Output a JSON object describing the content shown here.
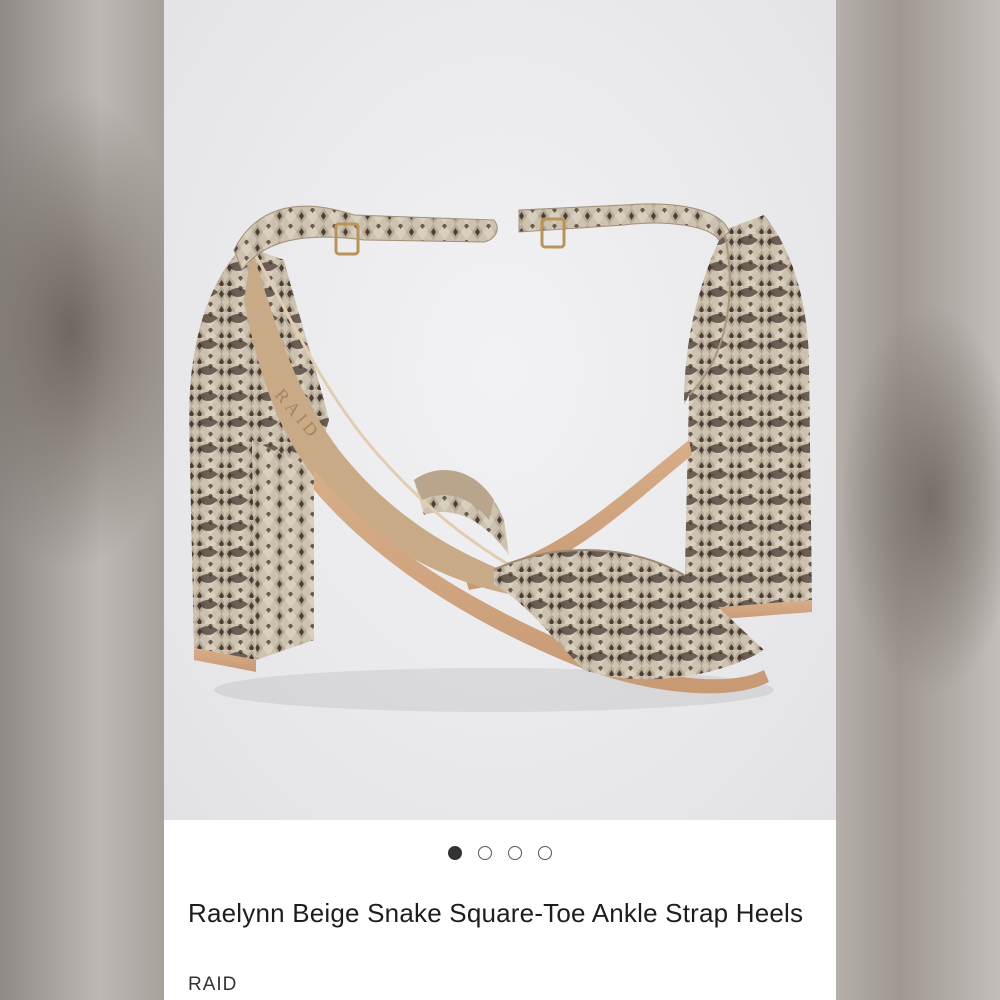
{
  "product": {
    "title": "Raelynn Beige Snake Square-Toe Ankle Strap Heels",
    "brand": "RAID",
    "insole_logo": "RAID"
  },
  "carousel": {
    "total_images": 4,
    "active_index": 0
  },
  "colors": {
    "snake_base": "#c9bda9",
    "snake_scale": "#5a4a40",
    "sole": "#d4a985",
    "buckle": "#b8935a"
  },
  "icons": [
    "carousel-dot-icon"
  ]
}
